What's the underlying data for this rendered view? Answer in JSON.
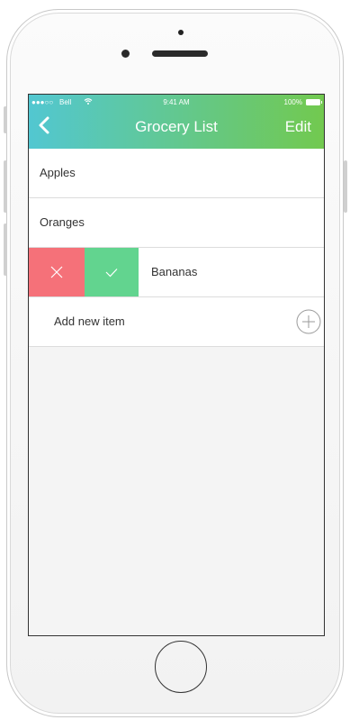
{
  "colors": {
    "gradient_start": "#52c7d1",
    "gradient_end": "#72c94f",
    "delete_red": "#f57179",
    "done_green": "#62d48f"
  },
  "status_bar": {
    "signal": "●●●○○",
    "carrier": "Bell",
    "time": "9:41 AM",
    "battery": "100%"
  },
  "nav": {
    "back_icon": "chevron-left-icon",
    "title": "Grocery List",
    "edit_label": "Edit"
  },
  "list": {
    "items": [
      {
        "label": "Apples"
      },
      {
        "label": "Oranges"
      },
      {
        "label": "Bananas",
        "swiped": true
      }
    ],
    "swipe_actions": {
      "delete_icon": "close-icon",
      "done_icon": "checkmark-icon"
    },
    "add_item": {
      "label": "Add new item",
      "icon": "plus-circle-icon"
    }
  }
}
